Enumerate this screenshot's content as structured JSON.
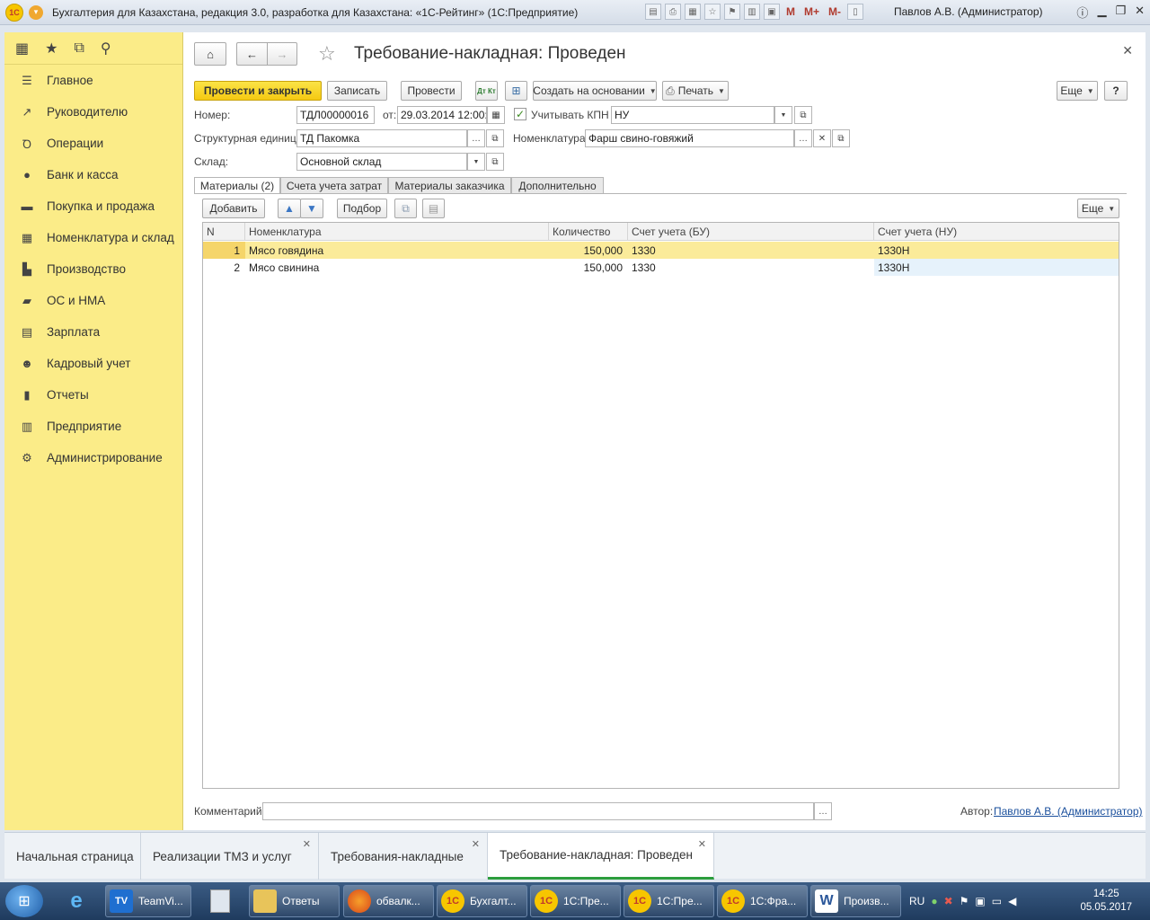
{
  "window": {
    "title": "Бухгалтерия для Казахстана, редакция 3.0, разработка для Казахстана: «1С-Рейтинг»  (1С:Предприятие)",
    "logo_text": "1С",
    "toolbar_marks": [
      "M",
      "M+",
      "M-"
    ],
    "user": "Павлов А.В. (Администратор)"
  },
  "sidebar": {
    "items": [
      {
        "label": "Главное",
        "icon": "menu-lines-icon"
      },
      {
        "label": "Руководителю",
        "icon": "trend-icon"
      },
      {
        "label": "Операции",
        "icon": "dt-kt-icon"
      },
      {
        "label": "Банк и касса",
        "icon": "coin-icon"
      },
      {
        "label": "Покупка и продажа",
        "icon": "cart-icon"
      },
      {
        "label": "Номенклатура и склад",
        "icon": "grid-icon"
      },
      {
        "label": "Производство",
        "icon": "factory-icon"
      },
      {
        "label": "ОС и НМА",
        "icon": "truck-icon"
      },
      {
        "label": "Зарплата",
        "icon": "list-icon"
      },
      {
        "label": "Кадровый учет",
        "icon": "people-icon"
      },
      {
        "label": "Отчеты",
        "icon": "bar-chart-icon"
      },
      {
        "label": "Предприятие",
        "icon": "building-icon"
      },
      {
        "label": "Администрирование",
        "icon": "gear-icon"
      }
    ]
  },
  "form": {
    "title": "Требование-накладная: Проведен",
    "buttons": {
      "post_close": "Провести и закрыть",
      "save": "Записать",
      "post": "Провести",
      "create_based": "Создать на основании",
      "print": "Печать",
      "more": "Еще",
      "help": "?",
      "dtkt": "Дт Кт"
    },
    "fields": {
      "number_label": "Номер:",
      "number_value": "ТДЛ00000016",
      "date_label": "от:",
      "date_value": "29.03.2014 12:00:0",
      "kpn_label": "Учитывать КПН",
      "kpn_checked": true,
      "nu_value": "НУ",
      "unit_label": "Структурная единица:",
      "unit_value": "ТД Пакомка",
      "nomenclature_label": "Номенклатура:",
      "nomenclature_value": "Фарш свино-говяжий",
      "warehouse_label": "Склад:",
      "warehouse_value": "Основной склад"
    },
    "tabs": [
      "Материалы (2)",
      "Счета учета затрат",
      "Материалы заказчика",
      "Дополнительно"
    ],
    "table_toolbar": {
      "add": "Добавить",
      "pick": "Подбор",
      "more": "Еще"
    },
    "table": {
      "columns": [
        "N",
        "Номенклатура",
        "Количество",
        "Счет учета (БУ)",
        "Счет учета (НУ)"
      ],
      "rows": [
        {
          "n": "1",
          "nomenclature": "Мясо говядина",
          "qty": "150,000",
          "bu": "1330",
          "nu": "1330Н"
        },
        {
          "n": "2",
          "nomenclature": "Мясо свинина",
          "qty": "150,000",
          "bu": "1330",
          "nu": "1330Н"
        }
      ]
    },
    "comment_label": "Комментарий:",
    "author_label": "Автор:",
    "author_value": "Павлов А.В. (Администратор)"
  },
  "window_tabs": [
    {
      "label": "Начальная страница",
      "closable": false
    },
    {
      "label": "Реализации ТМЗ и услуг",
      "closable": true
    },
    {
      "label": "Требования-накладные",
      "closable": true
    },
    {
      "label": "Требование-накладная: Проведен",
      "closable": true
    }
  ],
  "taskbar": {
    "items": [
      {
        "label": "TeamVi...",
        "icon_text": "TV"
      },
      {
        "label": "Ответы",
        "icon_text": ""
      },
      {
        "label": "обвалк...",
        "icon_text": ""
      },
      {
        "label": "Бухгалт...",
        "icon_text": "1С"
      },
      {
        "label": "1С:Пре...",
        "icon_text": "1С"
      },
      {
        "label": "1С:Пре...",
        "icon_text": "1С"
      },
      {
        "label": "1С:Фра...",
        "icon_text": "1С"
      },
      {
        "label": "Произв...",
        "icon_text": "W"
      }
    ],
    "lang": "RU",
    "time": "14:25",
    "date": "05.05.2017"
  }
}
